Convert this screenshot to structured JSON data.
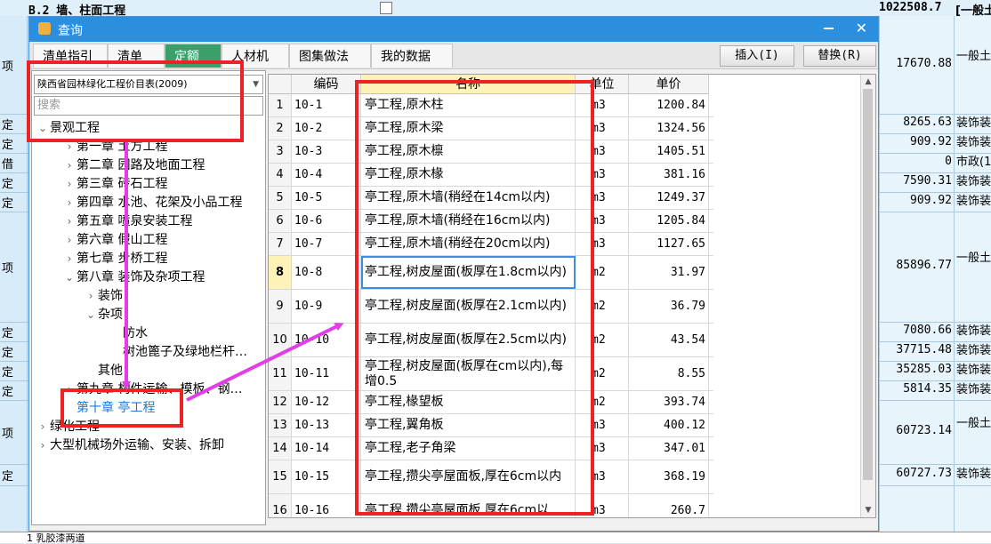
{
  "background": {
    "top_code": "B.2  墙、柱面工程",
    "top_amount": "1022508.7",
    "top_extra": "[一般土",
    "rows": [
      {
        "label": "项",
        "amount": "17670.88",
        "extra": "一般土 入差价"
      },
      {
        "label": "定",
        "amount": "8265.63",
        "extra": "装饰装"
      },
      {
        "label": "定",
        "amount": "909.92",
        "extra": "装饰装"
      },
      {
        "label": "借",
        "amount": "0",
        "extra": "市政(1"
      },
      {
        "label": "定",
        "amount": "7590.31",
        "extra": "装饰装"
      },
      {
        "label": "定",
        "amount": "909.92",
        "extra": "装饰装"
      },
      {
        "label": "项",
        "amount": "85896.77",
        "extra": "一般土 入差价"
      },
      {
        "label": "定",
        "amount": "7080.66",
        "extra": "装饰装"
      },
      {
        "label": "定",
        "amount": "37715.48",
        "extra": "装饰装"
      },
      {
        "label": "定",
        "amount": "35285.03",
        "extra": "装饰装"
      },
      {
        "label": "定",
        "amount": "5814.35",
        "extra": "装饰装"
      },
      {
        "label": "项",
        "amount": "60723.14",
        "extra": "一般土 入差价"
      },
      {
        "label": "定",
        "amount": "60727.73",
        "extra": "装饰装"
      }
    ],
    "bottom_text": "1  乳胶漆两道"
  },
  "dialog": {
    "title": "查询",
    "tabs": [
      "清单指引",
      "清单",
      "定额",
      "人材机",
      "图集做法",
      "我的数据"
    ],
    "active_tab": "定额",
    "insert_label": "插入(I)",
    "replace_label": "替换(R)"
  },
  "left": {
    "library": "陕西省园林绿化工程价目表(2009)",
    "search_placeholder": "搜索",
    "tree": [
      {
        "label": "景观工程",
        "arrow": "open",
        "level": 0
      },
      {
        "label": "第一章  土方工程",
        "arrow": "closed",
        "level": 1
      },
      {
        "label": "第二章  园路及地面工程",
        "arrow": "closed",
        "level": 1
      },
      {
        "label": "第三章  砖石工程",
        "arrow": "closed",
        "level": 1
      },
      {
        "label": "第四章  水池、花架及小品工程",
        "arrow": "closed",
        "level": 1
      },
      {
        "label": "第五章  喷泉安装工程",
        "arrow": "closed",
        "level": 1
      },
      {
        "label": "第六章  假山工程",
        "arrow": "closed",
        "level": 1
      },
      {
        "label": "第七章  步桥工程",
        "arrow": "closed",
        "level": 1
      },
      {
        "label": "第八章  装饰及杂项工程",
        "arrow": "open",
        "level": 1
      },
      {
        "label": "装饰",
        "arrow": "closed",
        "level": 2
      },
      {
        "label": "杂项",
        "arrow": "open",
        "level": 2
      },
      {
        "label": "防水",
        "arrow": "none",
        "level": 3
      },
      {
        "label": "树池篦子及绿地栏杆…",
        "arrow": "none",
        "level": 3
      },
      {
        "label": "其他",
        "arrow": "none",
        "level": 2
      },
      {
        "label": "第九章  构件运输、模板、钢…",
        "arrow": "closed",
        "level": 1
      },
      {
        "label": "第十章  亭工程",
        "arrow": "none",
        "level": 1,
        "selected": true
      },
      {
        "label": "绿化工程",
        "arrow": "closed",
        "level": 0
      },
      {
        "label": "大型机械场外运输、安装、拆卸",
        "arrow": "closed",
        "level": 0
      }
    ]
  },
  "table": {
    "headers": [
      "编码",
      "名称",
      "单位",
      "单价"
    ],
    "rows": [
      {
        "idx": "1",
        "code": "10-1",
        "name": "亭工程,原木柱",
        "unit": "m3",
        "price": "1200.84"
      },
      {
        "idx": "2",
        "code": "10-2",
        "name": "亭工程,原木梁",
        "unit": "m3",
        "price": "1324.56"
      },
      {
        "idx": "3",
        "code": "10-3",
        "name": "亭工程,原木檩",
        "unit": "m3",
        "price": "1405.51"
      },
      {
        "idx": "4",
        "code": "10-4",
        "name": "亭工程,原木椽",
        "unit": "m3",
        "price": "381.16"
      },
      {
        "idx": "5",
        "code": "10-5",
        "name": "亭工程,原木墙(稍经在14cm以内)",
        "unit": "m3",
        "price": "1249.37"
      },
      {
        "idx": "6",
        "code": "10-6",
        "name": "亭工程,原木墙(稍经在16cm以内)",
        "unit": "m3",
        "price": "1205.84"
      },
      {
        "idx": "7",
        "code": "10-7",
        "name": "亭工程,原木墙(稍经在20cm以内)",
        "unit": "m3",
        "price": "1127.65"
      },
      {
        "idx": "8",
        "code": "10-8",
        "name": "亭工程,树皮屋面(板厚在1.8cm以内)",
        "unit": "m2",
        "price": "31.97",
        "current": true
      },
      {
        "idx": "9",
        "code": "10-9",
        "name": "亭工程,树皮屋面(板厚在2.1cm以内)",
        "unit": "m2",
        "price": "36.79"
      },
      {
        "idx": "10",
        "code": "10-10",
        "name": "亭工程,树皮屋面(板厚在2.5cm以内)",
        "unit": "m2",
        "price": "43.54"
      },
      {
        "idx": "11",
        "code": "10-11",
        "name": "亭工程,树皮屋面(板厚在cm以内),每增0.5",
        "unit": "m2",
        "price": "8.55"
      },
      {
        "idx": "12",
        "code": "10-12",
        "name": "亭工程,椽望板",
        "unit": "m2",
        "price": "393.74"
      },
      {
        "idx": "13",
        "code": "10-13",
        "name": "亭工程,翼角板",
        "unit": "m3",
        "price": "400.12"
      },
      {
        "idx": "14",
        "code": "10-14",
        "name": "亭工程,老子角梁",
        "unit": "m3",
        "price": "347.01"
      },
      {
        "idx": "15",
        "code": "10-15",
        "name": "亭工程,攒尖亭屋面板,厚在6cm以内",
        "unit": "m3",
        "price": "368.19"
      },
      {
        "idx": "16",
        "code": "10-16",
        "name": "亭工程,攒尖亭屋面板,厚在6cm以",
        "unit": "m3",
        "price": "260.7"
      }
    ]
  },
  "annotation_color": "#ee2222",
  "arrow_color": "#e23de6"
}
